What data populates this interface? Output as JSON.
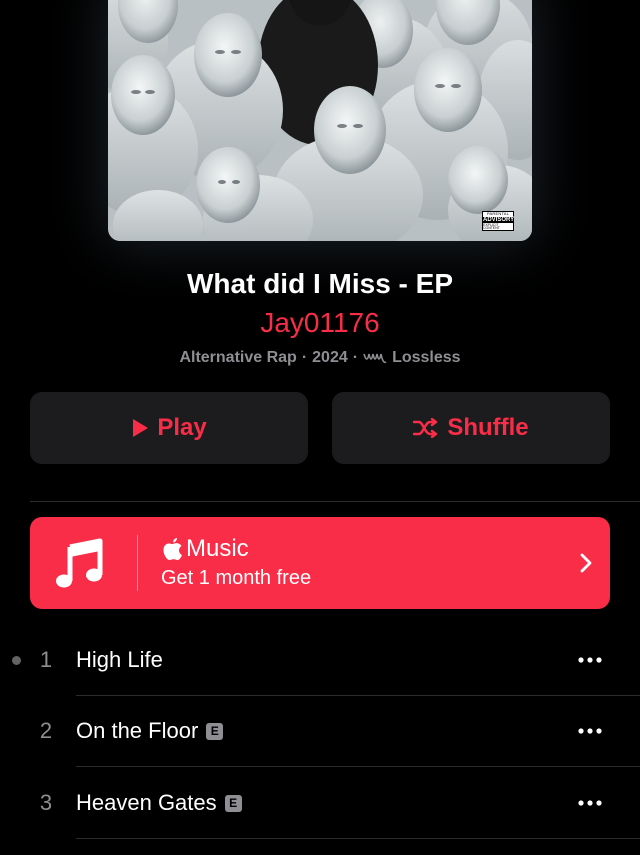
{
  "album": {
    "title": "What did I Miss - EP",
    "artist": "Jay01176",
    "genre": "Alternative Rap",
    "year": "2024",
    "separator": "·",
    "quality": "Lossless",
    "advisory": {
      "line1": "PARENTAL",
      "line2": "ADVISORY",
      "line3": "EXPLICIT CONTENT"
    }
  },
  "actions": {
    "play_label": "Play",
    "shuffle_label": "Shuffle"
  },
  "promo": {
    "brand_symbol": "",
    "brand_name": "Music",
    "subtitle": "Get 1 month free"
  },
  "tracks": [
    {
      "number": "1",
      "title": "High Life",
      "explicit": false,
      "playing": true
    },
    {
      "number": "2",
      "title": "On the Floor",
      "explicit": true,
      "explicit_mark": "E",
      "playing": false
    },
    {
      "number": "3",
      "title": "Heaven Gates",
      "explicit": true,
      "explicit_mark": "E",
      "playing": false
    }
  ],
  "colors": {
    "accent": "#fa2d48",
    "background": "#000000",
    "button_bg": "#1c1c1e",
    "secondary_text": "#8e8e93"
  },
  "icons": {
    "play": "play-icon",
    "shuffle": "shuffle-icon",
    "lossless": "lossless-icon",
    "music_note": "music-note-icon",
    "apple": "apple-logo-icon",
    "chevron": "chevron-right-icon",
    "more": "more-icon"
  }
}
